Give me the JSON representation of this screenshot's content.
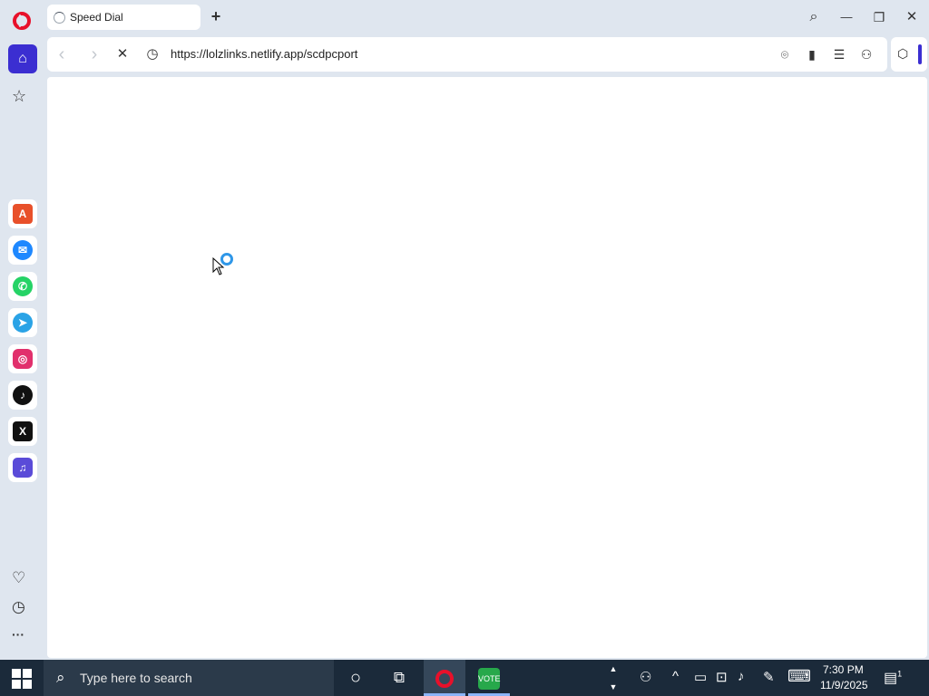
{
  "browser": {
    "tab": {
      "title": "Speed Dial"
    },
    "new_tab_label": "+",
    "address": {
      "url": "https://lolzlinks.netlify.app/scdpcport"
    },
    "window_controls": {
      "search": "⌕",
      "minimize": "—",
      "restore": "❐",
      "close": "✕"
    },
    "nav": {
      "back": "‹",
      "forward": "›",
      "stop": "✕",
      "site_info": "◷"
    },
    "address_right": {
      "snapshot": "⌾",
      "battery": "▮",
      "easy_setup": "☰",
      "account": "⚇"
    },
    "extensions": {
      "cube": "⬡"
    }
  },
  "sidebar": {
    "home": "⌂",
    "bookmarks": "☆",
    "apps": [
      {
        "name": "aria",
        "glyph": "A",
        "color": "#e8502a"
      },
      {
        "name": "messenger",
        "glyph": "✉",
        "color": "#1e88ff"
      },
      {
        "name": "whatsapp",
        "glyph": "✆",
        "color": "#25d366"
      },
      {
        "name": "telegram",
        "glyph": "➤",
        "color": "#2aa3e6"
      },
      {
        "name": "instagram",
        "glyph": "◎",
        "color": "#e1306c"
      },
      {
        "name": "tiktok",
        "glyph": "♪",
        "color": "#111111"
      },
      {
        "name": "x",
        "glyph": "X",
        "color": "#111111"
      },
      {
        "name": "music",
        "glyph": "♫",
        "color": "#5a4bd8"
      }
    ],
    "bottom": {
      "favorites": "♡",
      "history": "◷",
      "more": "···"
    }
  },
  "taskbar": {
    "search_placeholder": "Type here to search",
    "clock": {
      "time": "7:30 PM",
      "date": "11/9/2025"
    },
    "notification_count": "1",
    "tray": {
      "people": "⚇",
      "chevron": "^",
      "battery": "▭",
      "network": "⊡",
      "volume": "♪",
      "pen": "✎",
      "keyboard": "⌨"
    },
    "cortana": "○",
    "task_view": "⧉",
    "pinned_app_label": "VOTE"
  }
}
